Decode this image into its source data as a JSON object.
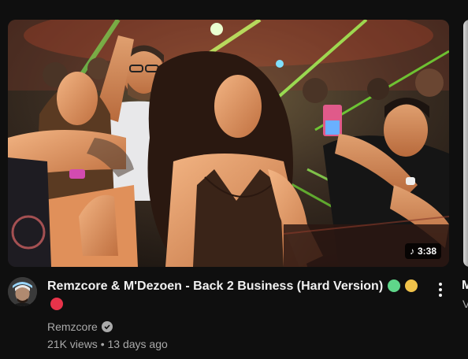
{
  "video": {
    "title": "Remzcore & M'Dezoen - Back 2 Business (Hard Version)",
    "title_badges": [
      {
        "icon": "green-circle-icon",
        "color": "#5fd68a"
      },
      {
        "icon": "yellow-circle-icon",
        "color": "#f0c24a"
      },
      {
        "icon": "red-circle-icon",
        "color": "#e8334a"
      }
    ],
    "duration": "3:38",
    "duration_icon": "music-note-icon",
    "channel": "Remzcore",
    "channel_verified_icon": "verified-badge-icon",
    "stats": "21K views • 13 days ago",
    "menu_icon": "more-vert-icon"
  },
  "next_video": {
    "title_fragment": "M",
    "sub_fragment": "V"
  },
  "colors": {
    "background": "#0f0f0f",
    "title_text": "#f1f1f1",
    "secondary_text": "#aaaaaa"
  }
}
